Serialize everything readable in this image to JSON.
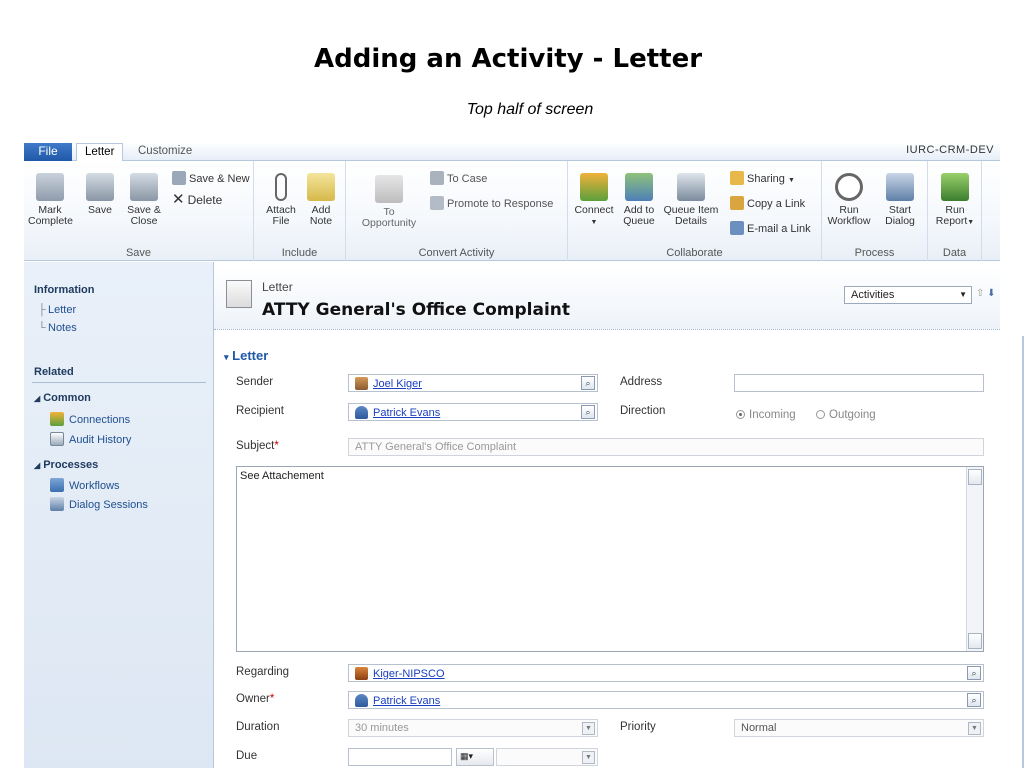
{
  "slide": {
    "title": "Adding an Activity - Letter",
    "subtitle": "Top half of screen"
  },
  "ribbon": {
    "tabs": {
      "file": "File",
      "letter": "Letter",
      "customize": "Customize"
    },
    "org": "IURC-CRM-DEV",
    "save_group": {
      "label": "Save",
      "mark_complete": "Mark\nComplete",
      "save": "Save",
      "save_close": "Save &\nClose",
      "save_new": "Save & New",
      "delete": "Delete"
    },
    "include_group": {
      "label": "Include",
      "attach_file": "Attach\nFile",
      "add_note": "Add\nNote"
    },
    "convert_group": {
      "label": "Convert Activity",
      "to_opportunity": "To\nOpportunity",
      "to_case": "To Case",
      "promote": "Promote to Response"
    },
    "collaborate_group": {
      "label": "Collaborate",
      "connect": "Connect",
      "add_to_queue": "Add to\nQueue",
      "queue_item_details": "Queue Item\nDetails",
      "sharing": "Sharing",
      "copy_link": "Copy a Link",
      "email_link": "E-mail a Link"
    },
    "process_group": {
      "label": "Process",
      "run_workflow": "Run\nWorkflow",
      "start_dialog": "Start\nDialog"
    },
    "data_group": {
      "label": "Data",
      "run_report": "Run\nReport"
    }
  },
  "nav": {
    "information": "Information",
    "letter": "Letter",
    "notes": "Notes",
    "related": "Related",
    "common": "Common",
    "connections": "Connections",
    "audit_history": "Audit History",
    "processes": "Processes",
    "workflows": "Workflows",
    "dialog_sessions": "Dialog Sessions"
  },
  "header": {
    "entity": "Letter",
    "title": "ATTY General's Office Complaint",
    "view_select": "Activities"
  },
  "form": {
    "section": "Letter",
    "sender_label": "Sender",
    "sender_value": "Joel Kiger",
    "address_label": "Address",
    "recipient_label": "Recipient",
    "recipient_value": "Patrick Evans",
    "direction_label": "Direction",
    "incoming": "Incoming",
    "outgoing": "Outgoing",
    "subject_label": "Subject",
    "subject_value": "ATTY General's Office Complaint",
    "description": "See Attachement",
    "regarding_label": "Regarding",
    "regarding_value": "Kiger-NIPSCO",
    "owner_label": "Owner",
    "owner_value": "Patrick Evans",
    "duration_label": "Duration",
    "duration_value": "30 minutes",
    "priority_label": "Priority",
    "priority_value": "Normal",
    "due_label": "Due"
  },
  "colors": {
    "accent": "#1f58a8",
    "link": "#1a3fbf",
    "required": "#cc0000"
  }
}
